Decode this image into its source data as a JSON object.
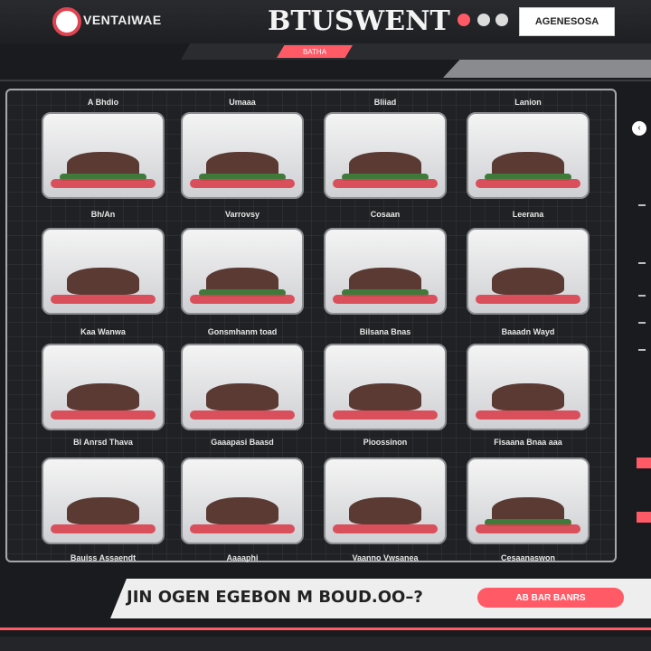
{
  "header": {
    "logo_text": "VENTAIWAE",
    "title": "BTUSWENT",
    "account_button": "AGENESOSA"
  },
  "nav": {
    "tabs": [
      "",
      "BATHA",
      ""
    ]
  },
  "menu": {
    "items": [
      {
        "label": "A Bhdio",
        "caption": "Bh/An"
      },
      {
        "label": "Umaaa",
        "caption": "Varrovsy"
      },
      {
        "label": "Bliiad",
        "caption": "Cosaan"
      },
      {
        "label": "Lanion",
        "caption": "Leerana"
      },
      {
        "label": "Pioossinon",
        "caption": "Kaa Wanwa"
      },
      {
        "label": "Fisaana Bnaa aaa",
        "caption": "Gonsmhanm toad"
      },
      {
        "label": "Bauiss Assaendt",
        "caption": "Bilsana Bnas"
      },
      {
        "label": "Aaaaphi",
        "caption": "Baaadn Wayd"
      },
      {
        "label": "Bl Anrsd Thava",
        "caption": "Vaanno Vwsanea"
      },
      {
        "label": "Gaaapasi Baasd",
        "caption": "Cesaanaswon"
      }
    ]
  },
  "footer": {
    "prompt_text": "JIN OGEN EGEBON M BOUD.OO–?",
    "action_button": "AB BAR BANRS"
  },
  "colors": {
    "accent": "#ff5a66",
    "background": "#1a1b1e",
    "panel_border": "#a6a7ab"
  }
}
